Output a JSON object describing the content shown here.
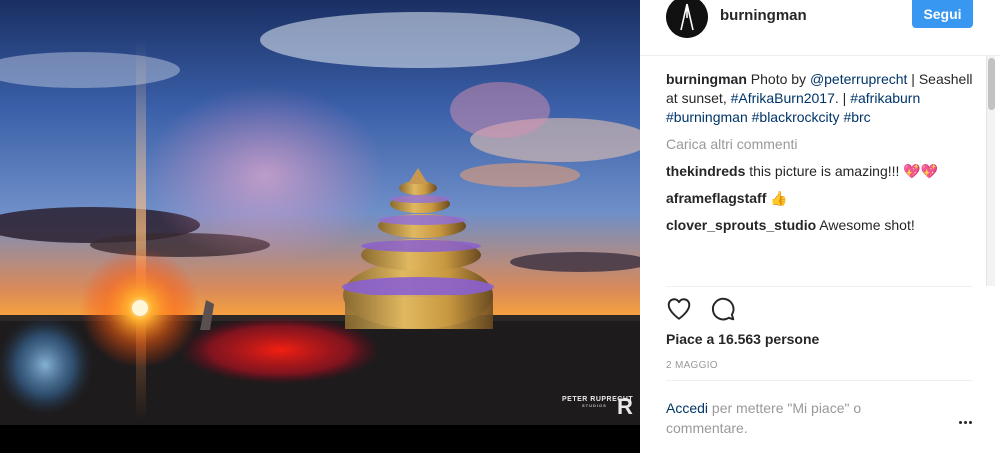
{
  "post": {
    "username": "burningman",
    "follow_label": "Segui",
    "caption": {
      "username": "burningman",
      "text_before": " Photo by ",
      "mention": "@peterruprecht",
      "text_mid": " | Seashell at sunset, ",
      "hashtag_event": "#AfrikaBurn2017",
      "text_after": ". | ",
      "tags": [
        "#afrikaburn",
        "#burningman",
        "#blackrockcity",
        "#brc"
      ]
    },
    "load_more_label": "Carica altri commenti",
    "comments": [
      {
        "username": "thekindreds",
        "text": " this picture is amazing!!! ",
        "emoji": "💖💖"
      },
      {
        "username": "aframeflagstaff",
        "text": " ",
        "emoji": "👍"
      },
      {
        "username": "clover_sprouts_studio",
        "text": " Awesome shot!",
        "emoji": ""
      }
    ],
    "likes_text": "Piace a 16.563 persone",
    "date": "2 MAGGIO",
    "login_prompt": {
      "link": "Accedi",
      "text": " per mettere \"Mi piace\" o commentare."
    },
    "photo_watermark": "PETER RUPRECHT",
    "photo_watermark_sub": "STUDIOS"
  },
  "icons": {
    "like": "heart-outline-icon",
    "comment": "speech-bubble-icon",
    "more": "more-options-icon"
  },
  "colors": {
    "accent": "#3897f0",
    "link": "#003569",
    "muted": "#999999",
    "text": "#262626"
  }
}
